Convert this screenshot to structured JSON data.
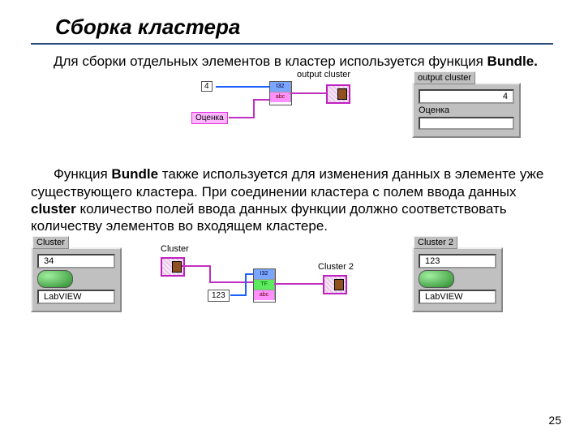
{
  "title": "Сборка кластера",
  "para1_pre": "Для сборки отдельных элементов в кластер используется функция ",
  "para1_bold": "Bundle.",
  "diagram1": {
    "const_val": "4",
    "str_const": "Оценка",
    "out_label": "output cluster",
    "panel_title": "output cluster",
    "panel_num": "4",
    "panel_str_label": "Оценка",
    "bundle_rows": [
      "I32",
      "abc"
    ]
  },
  "para2_pre": "Функция ",
  "para2_bold": "Bundle",
  "para2_mid": " также используется для изменения данных в элементе уже существующего кластера. При соединении кластера с полем ввода данных ",
  "para2_bold2": "cluster",
  "para2_post": " количество полей ввода данных функции должно соответствовать количеству элементов во входящем кластере.",
  "diagram2": {
    "cluster_in_title": "Cluster",
    "cluster_in_num": "34",
    "cluster_in_str": "LabVIEW",
    "mid_cluster_label": "Cluster",
    "const_val": "123",
    "out_label": "Cluster 2",
    "cluster_out_title": "Cluster 2",
    "cluster_out_num": "123",
    "cluster_out_str": "LabVIEW",
    "bundle_rows": [
      "I32",
      "TF",
      "abc"
    ]
  },
  "page_num": "25"
}
